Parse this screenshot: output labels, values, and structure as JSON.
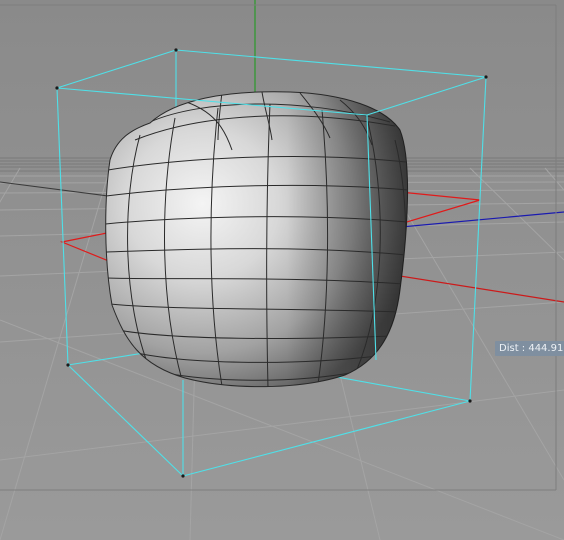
{
  "viewport": {
    "background_color": "#8c8c8c",
    "grid_color": "#9a9a9a",
    "axis_colors": {
      "x": "#cc1a1a",
      "y": "#2a9a2a",
      "z": "#1a1ab0"
    },
    "bounding_box_color": "#4fe0e8",
    "selection_plane_color": "#e01a1a",
    "object": "rounded-cube-mesh"
  },
  "distance_readout": {
    "label": "Dist : 444.91"
  }
}
